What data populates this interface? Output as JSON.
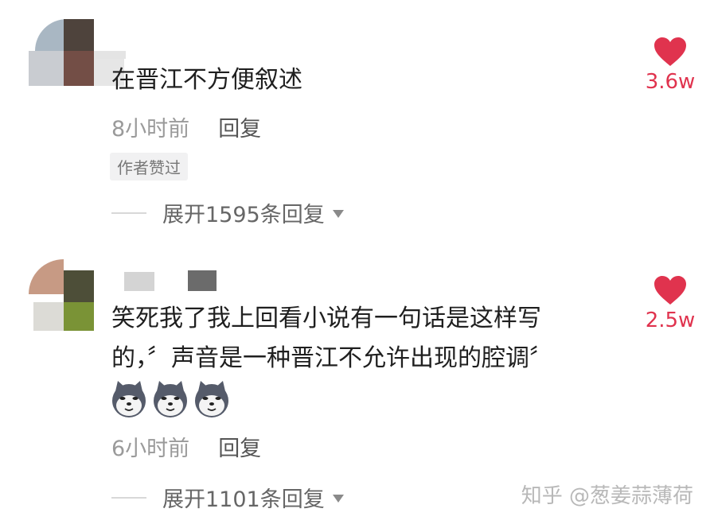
{
  "comments": [
    {
      "text": "在晋江不方便叙述",
      "time": "8小时前",
      "reply_label": "回复",
      "badge": "作者赞过",
      "likes": "3.6w",
      "expand_label": "展开1595条回复"
    },
    {
      "text_line1": "笑死我了我上回看小说有一句话是这样写",
      "text_line2": "的，〞声音是一种晋江不允许出现的腔调〞",
      "emoji_count": 3,
      "emoji_name": "doge-emoji",
      "time": "6小时前",
      "reply_label": "回复",
      "likes": "2.5w",
      "expand_label": "展开1101条回复"
    }
  ],
  "watermark": "知乎 @葱姜蒜薄荷",
  "colors": {
    "like": "#e0334e",
    "meta": "#9a9a9a"
  }
}
